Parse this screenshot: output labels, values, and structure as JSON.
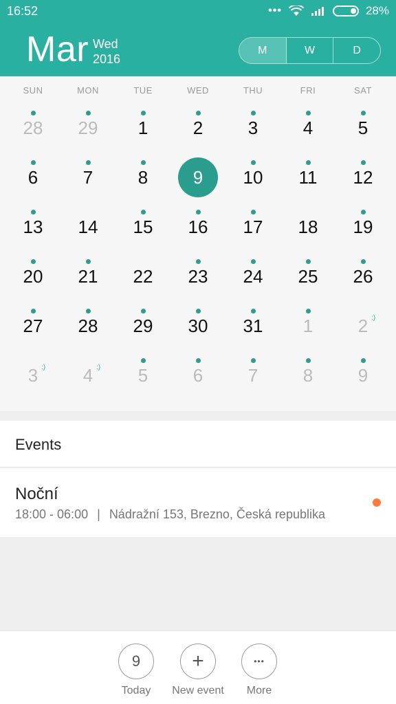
{
  "status": {
    "time": "16:52",
    "battery": "28%"
  },
  "header": {
    "month": "Mar",
    "weekday": "Wed",
    "year": "2016",
    "views": [
      "M",
      "W",
      "D"
    ],
    "active_view": "M"
  },
  "weekdays": [
    "SUN",
    "MON",
    "TUE",
    "WED",
    "THU",
    "FRI",
    "SAT"
  ],
  "weeks": [
    [
      {
        "d": "28",
        "dim": true,
        "dot": true
      },
      {
        "d": "29",
        "dim": true,
        "dot": true
      },
      {
        "d": "1",
        "dot": true
      },
      {
        "d": "2",
        "dot": true
      },
      {
        "d": "3",
        "dot": true
      },
      {
        "d": "4",
        "dot": true
      },
      {
        "d": "5",
        "dot": true
      }
    ],
    [
      {
        "d": "6",
        "dot": true
      },
      {
        "d": "7",
        "dot": true
      },
      {
        "d": "8",
        "dot": true
      },
      {
        "d": "9",
        "sel": true
      },
      {
        "d": "10",
        "dot": true
      },
      {
        "d": "11",
        "dot": true
      },
      {
        "d": "12",
        "dot": true
      }
    ],
    [
      {
        "d": "13",
        "dot": true
      },
      {
        "d": "14"
      },
      {
        "d": "15",
        "dot": true
      },
      {
        "d": "16",
        "dot": true
      },
      {
        "d": "17",
        "dot": true
      },
      {
        "d": "18"
      },
      {
        "d": "19",
        "dot": true
      }
    ],
    [
      {
        "d": "20",
        "dot": true
      },
      {
        "d": "21",
        "dot": true
      },
      {
        "d": "22"
      },
      {
        "d": "23",
        "dot": true
      },
      {
        "d": "24",
        "dot": true
      },
      {
        "d": "25",
        "dot": true
      },
      {
        "d": "26",
        "dot": true
      }
    ],
    [
      {
        "d": "27",
        "dot": true
      },
      {
        "d": "28",
        "dot": true
      },
      {
        "d": "29",
        "dot": true
      },
      {
        "d": "30",
        "dot": true
      },
      {
        "d": "31",
        "dot": true
      },
      {
        "d": "1",
        "dim": true,
        "dot": true
      },
      {
        "d": "2",
        "dim": true,
        "smile": ":)"
      }
    ],
    [
      {
        "d": "3",
        "dim": true,
        "smile": ":)"
      },
      {
        "d": "4",
        "dim": true,
        "smile": ":)"
      },
      {
        "d": "5",
        "dim": true,
        "dot": true
      },
      {
        "d": "6",
        "dim": true,
        "dot": true
      },
      {
        "d": "7",
        "dim": true,
        "dot": true
      },
      {
        "d": "8",
        "dim": true,
        "dot": true
      },
      {
        "d": "9",
        "dim": true,
        "dot": true
      }
    ]
  ],
  "events": {
    "title": "Events",
    "items": [
      {
        "name": "Noční",
        "time": "18:00 - 06:00",
        "separator": "|",
        "location": "Nádražní 153, Brezno, Česká republika",
        "color": "#ff7a3c"
      }
    ]
  },
  "bottom": {
    "today": {
      "icon_text": "9",
      "label": "Today"
    },
    "new_event": {
      "icon_text": "+",
      "label": "New event"
    },
    "more": {
      "icon_text": "•••",
      "label": "More"
    }
  },
  "colors": {
    "accent": "#2ab0a0",
    "selected": "#2a9d8f",
    "event_dot": "#ff7a3c"
  }
}
